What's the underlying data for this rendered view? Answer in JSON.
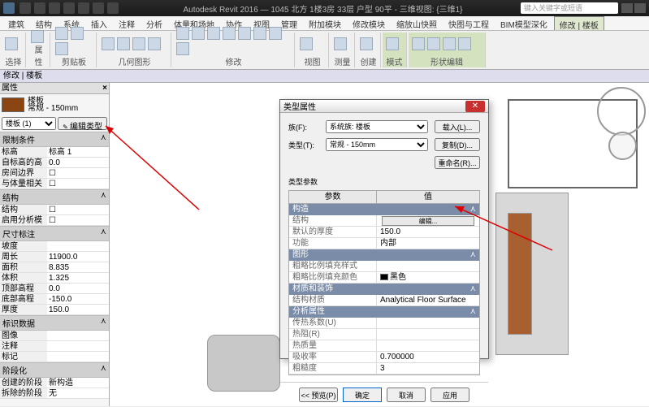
{
  "titlebar": {
    "app": "Autodesk Revit 2016",
    "doc": "1045 北方 1楼3房 33层 户型 90平 - 三维视图: {三维1}",
    "search_placeholder": "键入关键字或短语"
  },
  "ribbon": {
    "tabs": [
      "建筑",
      "结构",
      "系统",
      "插入",
      "注释",
      "分析",
      "体量和场地",
      "协作",
      "视图",
      "管理",
      "附加模块",
      "修改模块",
      "缩放山快照",
      "快图与工程",
      "BIM模型深化",
      "修改 | 楼板"
    ],
    "active_tab": "修改 | 楼板",
    "groups": [
      "选择",
      "属性",
      "剪贴板",
      "几何图形",
      "修改",
      "视图",
      "测量",
      "创建",
      "模式",
      "形状编辑"
    ]
  },
  "context_bar": "修改 | 楼板",
  "props": {
    "header": "属性",
    "type_name": "楼板",
    "type_desc": "常规 - 150mm",
    "instance_sel": "楼板 (1)",
    "edit_type_btn": "编辑类型",
    "sections": {
      "constraints": "限制条件",
      "structural": "结构",
      "dimensions": "尺寸标注",
      "identity": "标识数据",
      "phasing": "阶段化"
    },
    "rows": {
      "level": {
        "l": "标高",
        "v": "标高 1"
      },
      "offset": {
        "l": "自标高的高度偏移",
        "v": "0.0"
      },
      "room_bound": {
        "l": "房间边界",
        "v": ""
      },
      "mass_rel": {
        "l": "与体量相关",
        "v": ""
      },
      "structural_f": {
        "l": "结构",
        "v": ""
      },
      "analytical": {
        "l": "启用分析模型",
        "v": ""
      },
      "slope": {
        "l": "坡度",
        "v": ""
      },
      "perimeter": {
        "l": "周长",
        "v": "11900.0"
      },
      "area": {
        "l": "面积",
        "v": "8.835"
      },
      "volume": {
        "l": "体积",
        "v": "1.325"
      },
      "top_elev": {
        "l": "顶部高程",
        "v": "0.0"
      },
      "bot_elev": {
        "l": "底部高程",
        "v": "-150.0"
      },
      "thickness": {
        "l": "厚度",
        "v": "150.0"
      },
      "image": {
        "l": "图像",
        "v": ""
      },
      "comments": {
        "l": "注释",
        "v": ""
      },
      "mark": {
        "l": "标记",
        "v": ""
      },
      "phase_created": {
        "l": "创建的阶段",
        "v": "新构造"
      },
      "phase_demo": {
        "l": "拆除的阶段",
        "v": "无"
      }
    }
  },
  "dialog": {
    "title": "类型属性",
    "family_lbl": "族(F):",
    "family_val": "系统族: 楼板",
    "type_lbl": "类型(T):",
    "type_val": "常规 - 150mm",
    "btn_load": "载入(L)...",
    "btn_dup": "复制(D)...",
    "btn_rename": "重命名(R)...",
    "params_lbl": "类型参数",
    "col1": "参数",
    "col2": "值",
    "sections": {
      "construction": "构造",
      "graphics": "图形",
      "materials": "材质和装饰",
      "analytical": "分析属性",
      "analytical2": "分析属性"
    },
    "rows": {
      "structure": {
        "l": "结构",
        "btn": "编辑..."
      },
      "def_thick": {
        "l": "默认的厚度",
        "v": "150.0"
      },
      "function": {
        "l": "功能",
        "v": "内部"
      },
      "coarse_pat": {
        "l": "粗略比例填充样式",
        "v": ""
      },
      "coarse_col": {
        "l": "粗略比例填充颜色",
        "v": "黑色"
      },
      "struct_mat": {
        "l": "结构材质",
        "v": "Analytical Floor Surface"
      },
      "heat_coef": {
        "l": "传热系数(U)",
        "v": ""
      },
      "thermal_r": {
        "l": "热阻(R)",
        "v": ""
      },
      "thermal_m": {
        "l": "热质量",
        "v": ""
      },
      "absorptance": {
        "l": "吸收率",
        "v": "0.700000"
      },
      "roughness": {
        "l": "粗糙度",
        "v": "3"
      }
    },
    "preview_btn": "<< 预览(P)",
    "ok": "确定",
    "cancel": "取消",
    "apply": "应用"
  }
}
